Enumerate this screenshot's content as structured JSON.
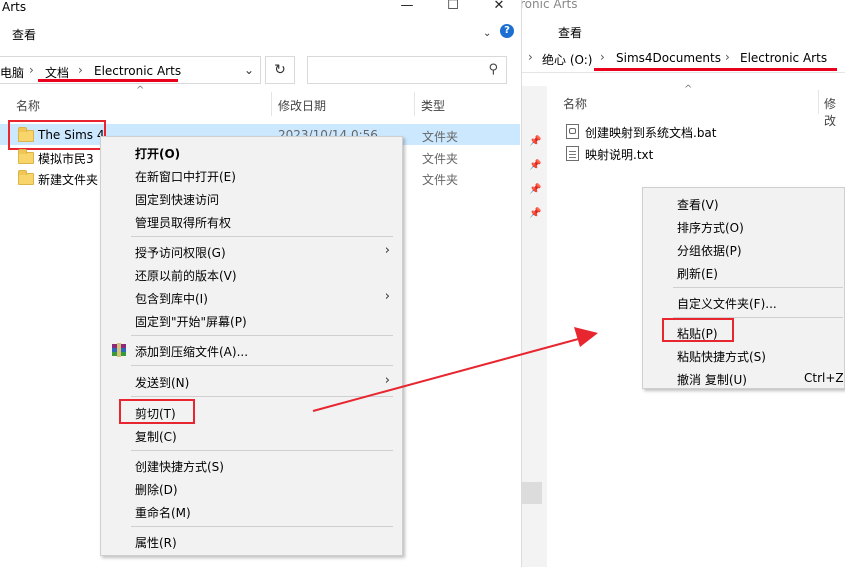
{
  "left_window": {
    "title": "Arts",
    "menu_view": "查看",
    "breadcrumbs": [
      "电脑",
      "文档",
      "Electronic Arts"
    ],
    "columns": {
      "name": "名称",
      "date": "修改日期",
      "type": "类型"
    },
    "rows": [
      {
        "name": "The Sims 4",
        "date": "2023/10/14 0:56",
        "type": "文件夹"
      },
      {
        "name": "模拟市民3",
        "date": "",
        "type": "文件夹"
      },
      {
        "name": "新建文件夹",
        "date": "",
        "type": "文件夹"
      }
    ],
    "search_placeholder": ""
  },
  "context_menu_left": {
    "items": [
      {
        "label": "打开(O)",
        "bold": true
      },
      {
        "label": "在新窗口中打开(E)"
      },
      {
        "label": "固定到快速访问"
      },
      {
        "label": "管理员取得所有权"
      },
      {
        "label": "授予访问权限(G)",
        "submenu": true
      },
      {
        "label": "还原以前的版本(V)"
      },
      {
        "label": "包含到库中(I)",
        "submenu": true
      },
      {
        "label": "固定到\"开始\"屏幕(P)"
      },
      {
        "label": "添加到压缩文件(A)..."
      },
      {
        "label": "发送到(N)",
        "submenu": true
      },
      {
        "label": "剪切(T)",
        "highlighted": true
      },
      {
        "label": "复制(C)"
      },
      {
        "label": "创建快捷方式(S)"
      },
      {
        "label": "删除(D)"
      },
      {
        "label": "重命名(M)"
      },
      {
        "label": "属性(R)"
      }
    ]
  },
  "right_window": {
    "title": "ronic Arts",
    "menu_view": "查看",
    "breadcrumbs": [
      "绝心 (O:)",
      "Sims4Documents",
      "Electronic Arts"
    ],
    "columns": {
      "name": "名称",
      "date": "修改"
    },
    "files": [
      {
        "name": "创建映射到系统文档.bat",
        "icon": "bat-file-icon"
      },
      {
        "name": "映射说明.txt",
        "icon": "txt-file-icon"
      }
    ]
  },
  "context_menu_right": {
    "items": [
      {
        "label": "查看(V)",
        "submenu": true
      },
      {
        "label": "排序方式(O)",
        "submenu": true
      },
      {
        "label": "分组依据(P)",
        "submenu": true
      },
      {
        "label": "刷新(E)"
      },
      {
        "label": "自定义文件夹(F)..."
      },
      {
        "label": "粘贴(P)",
        "highlighted": true
      },
      {
        "label": "粘贴快捷方式(S)"
      },
      {
        "label": "撤消 复制(U)",
        "shortcut": "Ctrl+Z"
      }
    ]
  },
  "colors": {
    "annotation_red": "#e8262f",
    "folder_yellow": "#f7d56a",
    "menu_bg": "#f2f2f2"
  }
}
